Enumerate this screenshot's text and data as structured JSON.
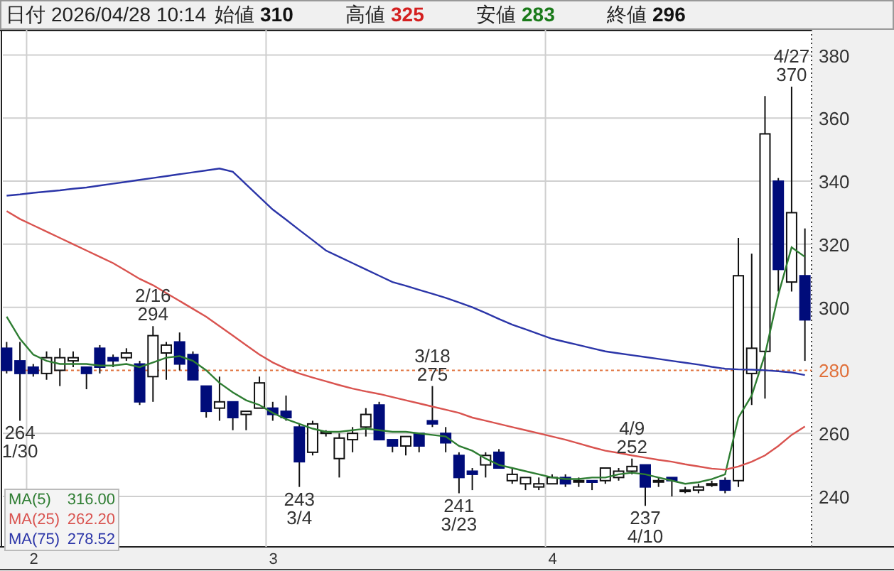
{
  "header": {
    "date_label": "日付",
    "datetime": "2026/04/28 10:14",
    "fields": [
      {
        "label": "始値",
        "value": "310",
        "color": "#111111"
      },
      {
        "label": "高値",
        "value": "325",
        "color": "#d42020"
      },
      {
        "label": "安値",
        "value": "283",
        "color": "#1a7a1a"
      },
      {
        "label": "終値",
        "value": "296",
        "color": "#111111"
      }
    ]
  },
  "chart": {
    "chart_data": {
      "type": "candlestick",
      "grid": true,
      "yticks": [
        240,
        260,
        280,
        300,
        320,
        340,
        360,
        380
      ],
      "ylim": [
        224,
        388
      ],
      "categories": [
        null,
        null,
        null,
        null,
        null,
        null,
        null,
        null,
        null,
        null,
        null,
        null,
        null,
        null,
        null,
        null,
        null,
        null,
        null,
        null,
        null,
        null,
        null,
        null,
        null,
        null,
        null,
        null,
        null,
        null,
        null,
        null,
        null,
        null,
        null,
        null,
        null,
        null,
        null,
        null,
        null,
        null,
        null,
        null,
        null,
        null,
        null,
        null,
        null,
        null,
        null,
        null,
        null,
        null,
        null,
        null,
        null,
        null,
        null,
        null,
        null
      ],
      "ohlc": [
        [
          287,
          289,
          279,
          280
        ],
        [
          283,
          289,
          264,
          279
        ],
        [
          281,
          282,
          278,
          279
        ],
        [
          279,
          286,
          277,
          284
        ],
        [
          280,
          287,
          275,
          284
        ],
        [
          283,
          286,
          281,
          284
        ],
        [
          281,
          281,
          274,
          279
        ],
        [
          287,
          288,
          279,
          281
        ],
        [
          284,
          285,
          281,
          283
        ],
        [
          284,
          287,
          283,
          285.5
        ],
        [
          282,
          283,
          269,
          270
        ],
        [
          278,
          294,
          270,
          291
        ],
        [
          285.5,
          289,
          277,
          288
        ],
        [
          289,
          292,
          280,
          282
        ],
        [
          285,
          286,
          277,
          277
        ],
        [
          275,
          275,
          265,
          267
        ],
        [
          268,
          278,
          264,
          270
        ],
        [
          270,
          270,
          261,
          265
        ],
        [
          266,
          267,
          261,
          267
        ],
        [
          268,
          278,
          268,
          276
        ],
        [
          268,
          270,
          264,
          266
        ],
        [
          267,
          272,
          264,
          265
        ],
        [
          262,
          263,
          243,
          251
        ],
        [
          254,
          264,
          253,
          263
        ],
        [
          260,
          261,
          259,
          260.5
        ],
        [
          252,
          260,
          246,
          258.5
        ],
        [
          258,
          262,
          254,
          260
        ],
        [
          262,
          268,
          259,
          266
        ],
        [
          269,
          270,
          258,
          258
        ],
        [
          258,
          258,
          254,
          256
        ],
        [
          256,
          259,
          253,
          259
        ],
        [
          260,
          260,
          254,
          256
        ],
        [
          264,
          275,
          262,
          263
        ],
        [
          260,
          262,
          254,
          257
        ],
        [
          253,
          254,
          241,
          246
        ],
        [
          248,
          249,
          242,
          247
        ],
        [
          250,
          254,
          246,
          253
        ],
        [
          254,
          255,
          249,
          249
        ],
        [
          245,
          249,
          244,
          247
        ],
        [
          244,
          246,
          242,
          246
        ],
        [
          243,
          246,
          242,
          244
        ],
        [
          244,
          247,
          244,
          246
        ],
        [
          246,
          247,
          243,
          244
        ],
        [
          245,
          246,
          243,
          245
        ],
        [
          245,
          245,
          242,
          244.5
        ],
        [
          245,
          249,
          244,
          249
        ],
        [
          246,
          249,
          245,
          248
        ],
        [
          248,
          252,
          247,
          249.5
        ],
        [
          250,
          250,
          237,
          243
        ],
        [
          245,
          246,
          243,
          245
        ],
        [
          246,
          246,
          240,
          245
        ],
        [
          242,
          243,
          241,
          242
        ],
        [
          242,
          244,
          241,
          243
        ],
        [
          244,
          245,
          243,
          244
        ],
        [
          245,
          246,
          241,
          242
        ],
        [
          245,
          322,
          243,
          310
        ],
        [
          279,
          317,
          269,
          287
        ],
        [
          286,
          367,
          271,
          355
        ],
        [
          340,
          341,
          305,
          312
        ],
        [
          308,
          370,
          305,
          330
        ],
        [
          310,
          325,
          283,
          296
        ]
      ],
      "series": [
        {
          "name": "MA(5)",
          "type": "line",
          "color": "#2e7d32",
          "values": [
            297,
            290,
            285,
            283,
            282,
            282,
            282,
            281.5,
            281.5,
            282,
            281,
            282.5,
            284,
            284.5,
            283,
            280,
            276,
            273,
            270.5,
            269,
            266.5,
            264.5,
            263,
            261.5,
            260.5,
            260.5,
            261,
            261.5,
            261,
            260.5,
            260.5,
            260,
            259.5,
            259,
            256,
            254.5,
            252,
            250,
            249,
            248,
            247,
            246,
            245.5,
            245.5,
            246,
            246,
            247,
            247.5,
            247,
            246,
            245,
            244,
            244.5,
            245.5,
            247,
            265,
            272,
            285,
            304,
            319,
            316
          ]
        },
        {
          "name": "MA(25)",
          "type": "line",
          "color": "#d9534f",
          "values": [
            330.5,
            328,
            326,
            324,
            322,
            320,
            318,
            316,
            314,
            311.5,
            309,
            307,
            304.5,
            302,
            299.5,
            297,
            294,
            291,
            288,
            285,
            282.5,
            280.5,
            279,
            277.7,
            276.5,
            275.3,
            274.2,
            273.3,
            272.5,
            271.5,
            270.5,
            269.5,
            268.5,
            267.5,
            266.5,
            265,
            264,
            263,
            262,
            261,
            260,
            259,
            258,
            256.8,
            255.6,
            254.5,
            253.8,
            253,
            252.3,
            251.6,
            251,
            250.2,
            249.5,
            248.8,
            248.5,
            249.5,
            251,
            253,
            256,
            259.5,
            262.2
          ]
        },
        {
          "name": "MA(75)",
          "type": "line",
          "color": "#2b35a8",
          "values": [
            335.4,
            335.8,
            336.3,
            336.7,
            337.1,
            337.6,
            338,
            338.6,
            339.2,
            339.8,
            340.4,
            341,
            341.6,
            342.2,
            342.8,
            343.4,
            344,
            343,
            339,
            335,
            331,
            327.8,
            324.5,
            321.3,
            318,
            316,
            314,
            312,
            310,
            308,
            306.8,
            305.5,
            304.3,
            303,
            301.5,
            300,
            298.2,
            296.3,
            294.5,
            293,
            291.5,
            290,
            289,
            288,
            287,
            286,
            285.4,
            284.8,
            284.2,
            283.6,
            283,
            282.4,
            281.8,
            281.1,
            280.5,
            280.3,
            280.2,
            280,
            279.7,
            279.3,
            278.5
          ]
        }
      ],
      "ref_lines": [
        {
          "axis": "y",
          "value": 280,
          "color": "#e0703a"
        }
      ]
    },
    "month_labels": [
      "2",
      "3",
      "4"
    ],
    "extreme_labels": [
      {
        "kind": "low",
        "value": "264",
        "date": "1/30"
      },
      {
        "kind": "high",
        "value": "294",
        "date": "2/16"
      },
      {
        "kind": "low",
        "value": "243",
        "date": "3/4"
      },
      {
        "kind": "high",
        "value": "275",
        "date": "3/18"
      },
      {
        "kind": "low",
        "value": "241",
        "date": "3/23"
      },
      {
        "kind": "high",
        "value": "252",
        "date": "4/9"
      },
      {
        "kind": "low",
        "value": "237",
        "date": "4/10"
      },
      {
        "kind": "high",
        "value": "370",
        "date": "4/27"
      }
    ],
    "legend_values": [
      "316.00",
      "262.20",
      "278.52"
    ]
  }
}
